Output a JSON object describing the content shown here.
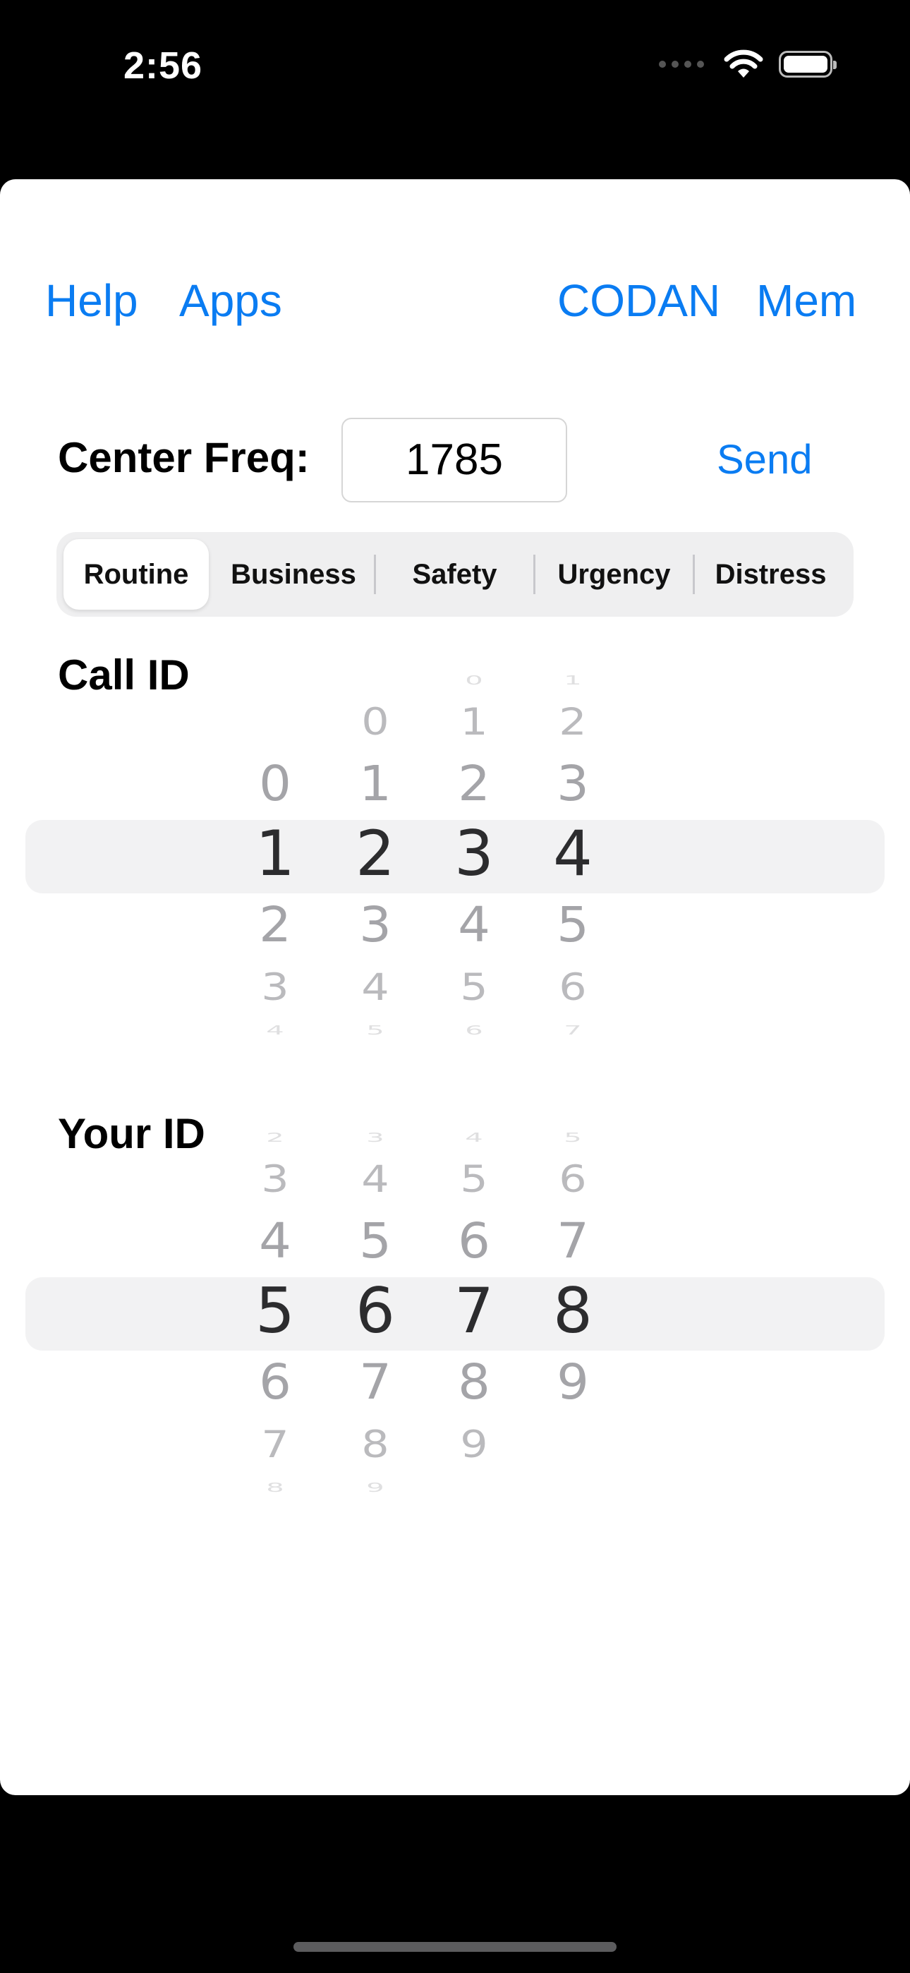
{
  "status_bar": {
    "time": "2:56"
  },
  "nav": {
    "help": "Help",
    "apps": "Apps",
    "codan": "CODAN",
    "mem": "Mem"
  },
  "freq": {
    "label": "Center Freq:",
    "value": "1785",
    "send": "Send"
  },
  "segments": [
    "Routine",
    "Business",
    "Safety",
    "Urgency",
    "Distress"
  ],
  "selected_segment": "Routine",
  "call_id": {
    "label": "Call ID",
    "columns": [
      [
        "0",
        "1",
        "2",
        "3",
        "4"
      ],
      [
        "0",
        "1",
        "2",
        "3",
        "4",
        "5"
      ],
      [
        "0",
        "1",
        "2",
        "3",
        "4",
        "5",
        "6"
      ],
      [
        "1",
        "2",
        "3",
        "4",
        "5",
        "6",
        "7"
      ]
    ],
    "selected": [
      "1",
      "2",
      "3",
      "4"
    ]
  },
  "your_id": {
    "label": "Your ID",
    "columns": [
      [
        "2",
        "3",
        "4",
        "5",
        "6",
        "7",
        "8"
      ],
      [
        "3",
        "4",
        "5",
        "6",
        "7",
        "8",
        "9"
      ],
      [
        "4",
        "5",
        "6",
        "7",
        "8",
        "9"
      ],
      [
        "5",
        "6",
        "7",
        "8",
        "9"
      ]
    ],
    "selected": [
      "5",
      "6",
      "7",
      "8"
    ]
  }
}
